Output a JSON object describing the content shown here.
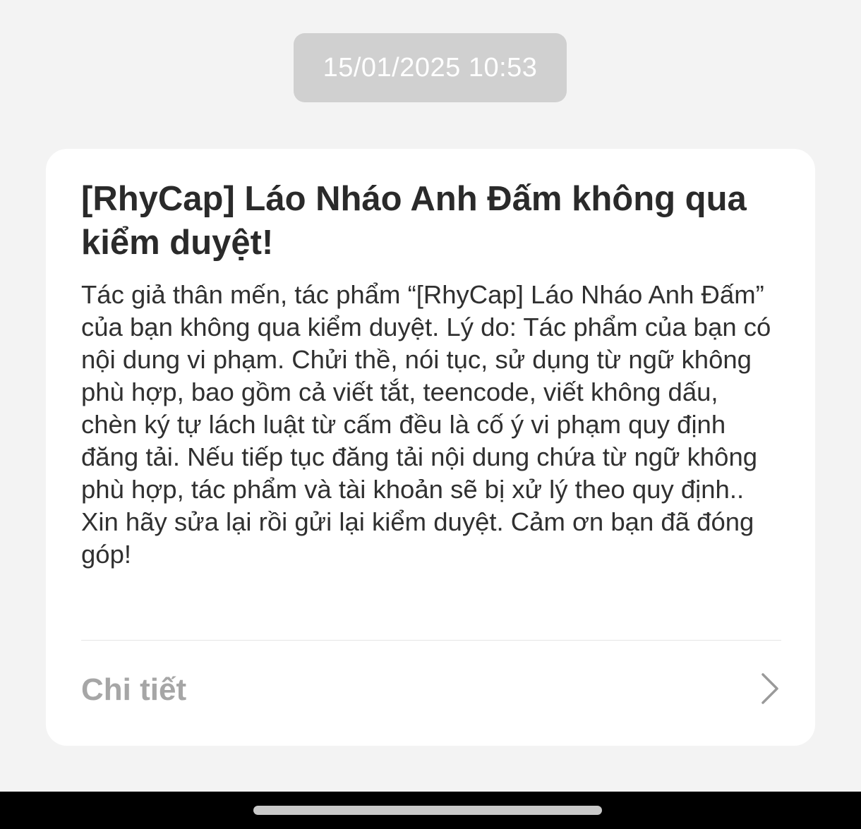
{
  "timestamp": "15/01/2025 10:53",
  "notification": {
    "title": "[RhyCap] Láo Nháo Anh Đấm không qua kiểm duyệt!",
    "paragraph_1": "Tác giả thân mến, tác phẩm “[RhyCap] Láo Nháo Anh Đấm” của bạn không qua kiểm duyệt. Lý do: Tác phẩm của bạn có nội dung vi phạm. Chửi thề, nói tục, sử dụng từ ngữ không phù hợp, bao gồm cả viết tắt, teencode, viết không dấu, chèn ký tự lách luật từ cấm đều là cố ý vi phạm quy định đăng tải. Nếu tiếp tục đăng tải nội dung chứa từ ngữ không phù hợp, tác phẩm và tài khoản sẽ bị xử lý theo quy định..",
    "paragraph_2": "Xin hãy sửa lại rồi gửi lại kiểm duyệt. Cảm ơn bạn đã đóng góp!",
    "details_label": "Chi tiết",
    "details_icon": "chevron-right-icon"
  },
  "colors": {
    "background": "#f3f3f3",
    "card": "#ffffff",
    "timestamp_pill": "#d0d0d0",
    "title_text": "#2a2a2a",
    "body_text": "#303030",
    "muted_text": "#a6a6a6",
    "nav_bar": "#000000"
  }
}
